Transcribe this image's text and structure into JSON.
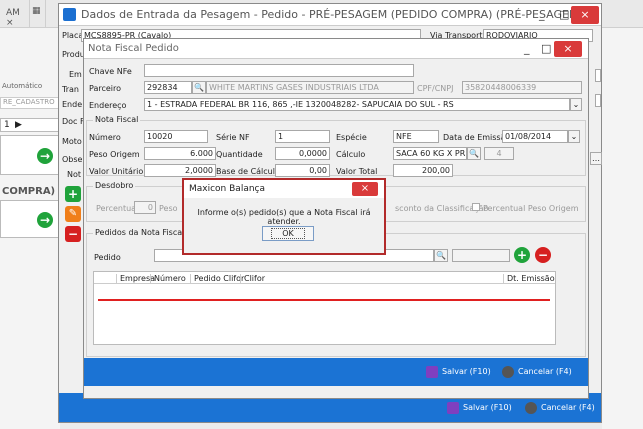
{
  "background": {
    "tab_label": "AM",
    "left_labels": [
      "Automático",
      "RE_CADASTRO",
      "COMPRA)"
    ],
    "side_labels": [
      "Em",
      "Tran",
      "Ende",
      "Doc F",
      "Moto",
      "Obser",
      "Not"
    ]
  },
  "outer_window": {
    "title": "Dados de Entrada da Pesagem - Pedido - PRÉ-PESAGEM (PEDIDO COMPRA) (PRÉ-PESAGEM)",
    "placa_label": "Placa",
    "placa_value": "MCS8895-PR (Cavalo)",
    "via_label": "Via Transporte",
    "via_value": "RODOVIARIO",
    "produ_label": "Produ",
    "save_label": "Salvar (F10)",
    "cancel_label": "Cancelar (F4)",
    "minimize": "_",
    "maximize": "□",
    "close": "×"
  },
  "inner_window": {
    "title": "Nota Fiscal Pedido",
    "minimize": "_",
    "maximize": "□",
    "close": "×",
    "chave_label": "Chave NFe",
    "chave_value": "",
    "parceiro_label": "Parceiro",
    "parceiro_code": "292834",
    "parceiro_name": "WHITE MARTINS GASES INDUSTRIAIS LTDA",
    "cpf_label": "CPF/CNPJ",
    "cpf_value": "35820448006339",
    "endereco_label": "Endereço",
    "endereco_value": "1 - ESTRADA FEDERAL BR 116, 865 ,-IE 1320048282- SAPUCAIA DO SUL - RS",
    "nota_group": "Nota Fiscal",
    "numero_label": "Número",
    "numero_value": "10020",
    "serie_label": "Série NF",
    "serie_value": "1",
    "especie_label": "Espécie",
    "especie_value": "NFE",
    "data_label": "Data de Emissão",
    "data_value": "01/08/2014",
    "peso_label": "Peso Origem",
    "peso_value": "6.000",
    "quantidade_label": "Quantidade",
    "quantidade_value": "0,0000",
    "calculo_label": "Cálculo",
    "calculo_value": "SACA 60 KG X PRECO",
    "calculo_extra": "4",
    "valor_unit_label": "Valor Unitário",
    "valor_unit_value": "2,0000",
    "base_label": "Base de Cálculo",
    "base_value": "0,00",
    "valor_total_label": "Valor Total",
    "valor_total_value": "200,00",
    "desdobro_group": "Desdobro",
    "percentual_label": "Percentual",
    "percentual_value": "0",
    "peso_short": "Peso",
    "desconto_label": "sconto da Classificação",
    "percentual_peso_label": "Percentual Peso Origem",
    "pedidos_group": "Pedidos da Nota Fiscal",
    "pedido_label": "Pedido",
    "table_headers": [
      "Empresa",
      "Número",
      "Pedido Clifor",
      "Clifor",
      "Dt. Emissão"
    ],
    "save_label": "Salvar (F10)",
    "cancel_label": "Cancelar (F4)"
  },
  "dialog": {
    "title": "Maxicon Balança",
    "message": "Informe o(s) pedido(s) que a Nota Fiscal irá atender.",
    "ok_label": "OK",
    "close": "×"
  },
  "colors": {
    "accent_blue": "#1b73d4",
    "dialog_border": "#b22a2a",
    "red_line": "#e02020"
  }
}
